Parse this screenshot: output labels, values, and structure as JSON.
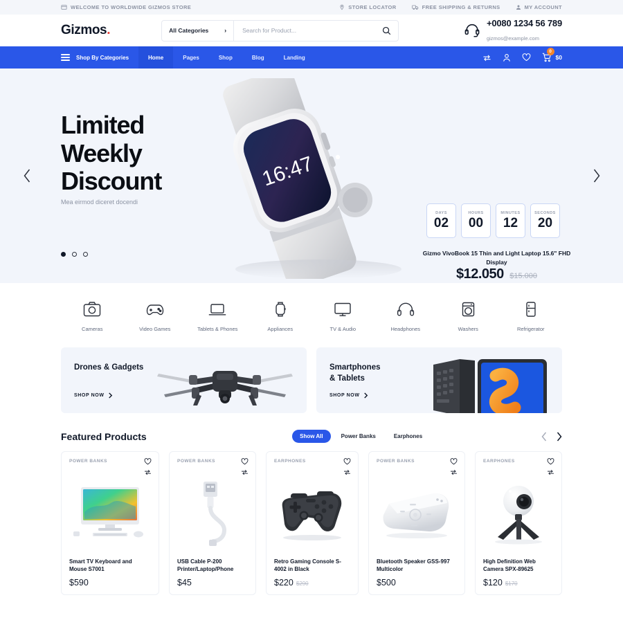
{
  "topbar": {
    "welcome": "WELCOME TO WORLDWIDE GIZMOS STORE",
    "welcome_icon": "store-icon",
    "links": [
      {
        "label": "STORE LOCATOR",
        "icon": "map-pin-icon"
      },
      {
        "label": "FREE SHIPPING & RETURNS",
        "icon": "truck-icon"
      },
      {
        "label": "MY ACCOUNT",
        "icon": "user-icon"
      }
    ]
  },
  "header": {
    "logo": "Gizmos",
    "logo_dot": ".",
    "category_select": "All Categories",
    "search_placeholder": "Search for Product...",
    "search_value": "",
    "search_icon": "search-icon",
    "support_icon": "headset-icon",
    "phone": "+0080 1234 56 789",
    "email": "gizmos@example.com"
  },
  "nav": {
    "categories_label": "Shop By Categories",
    "items": [
      {
        "label": "Home",
        "active": true
      },
      {
        "label": "Pages",
        "active": false
      },
      {
        "label": "Shop",
        "active": false
      },
      {
        "label": "Blog",
        "active": false
      },
      {
        "label": "Landing",
        "active": false
      }
    ],
    "compare_icon": "compare-icon",
    "account_icon": "user-icon",
    "wishlist_icon": "heart-icon",
    "cart_icon": "cart-icon",
    "cart_count": "0",
    "cart_total": "$0",
    "accent_color": "#2a57e8",
    "badge_color": "#f5862b"
  },
  "hero": {
    "title_line1": "Limited",
    "title_line2": "Weekly",
    "title_line3": "Discount",
    "subtitle": "Mea eirmod diceret docendi",
    "prev_icon": "chevron-left-icon",
    "next_icon": "chevron-right-icon",
    "slide_dots": [
      true,
      false,
      false
    ],
    "countdown": [
      {
        "label": "DAYS",
        "value": "02"
      },
      {
        "label": "HOURS",
        "value": "00"
      },
      {
        "label": "MINUTES",
        "value": "12"
      },
      {
        "label": "SECONDS",
        "value": "20"
      }
    ],
    "product_name": "Gizmo VivoBook 15 Thin and Light Laptop 15.6\" FHD Display",
    "price": "$12.050",
    "old_price": "$15.000"
  },
  "categories": [
    {
      "label": "Cameras",
      "icon": "camera-icon"
    },
    {
      "label": "Video Games",
      "icon": "gamepad-icon"
    },
    {
      "label": "Tablets & Phones",
      "icon": "laptop-icon"
    },
    {
      "label": "Appliances",
      "icon": "smartwatch-icon"
    },
    {
      "label": "TV & Audio",
      "icon": "monitor-icon"
    },
    {
      "label": "Headphones",
      "icon": "headphones-icon"
    },
    {
      "label": "Washers",
      "icon": "washer-icon"
    },
    {
      "label": "Refrigerator",
      "icon": "fridge-icon"
    }
  ],
  "promos": [
    {
      "title": "Drones & Gadgets",
      "cta": "SHOP NOW",
      "cta_icon": "chevron-right-icon",
      "image": "drone-image"
    },
    {
      "title_line1": "Smartphones",
      "title_line2": "& Tablets",
      "title": "Smartphones & Tablets",
      "cta": "SHOP NOW",
      "cta_icon": "chevron-right-icon",
      "image": "tablet-keyboard-image"
    }
  ],
  "featured": {
    "title": "Featured Products",
    "tabs": [
      {
        "label": "Show All",
        "active": true
      },
      {
        "label": "Power Banks",
        "active": false
      },
      {
        "label": "Earphones",
        "active": false
      }
    ],
    "prev_icon": "chevron-left-icon",
    "next_icon": "chevron-right-icon",
    "wishlist_icon": "heart-icon",
    "compare_icon": "compare-icon",
    "products": [
      {
        "tag": "POWER BANKS",
        "name": "Smart TV Keyboard and Mouse S7001",
        "price": "$590",
        "old_price": "",
        "image": "monitor-image"
      },
      {
        "tag": "POWER BANKS",
        "name": "USB Cable P-200 Printer/Laptop/Phone",
        "price": "$45",
        "old_price": "",
        "image": "usb-cable-image"
      },
      {
        "tag": "EARPHONES",
        "name": "Retro Gaming Console S-4002 in Black",
        "price": "$220",
        "old_price": "$290",
        "image": "gamepad-image"
      },
      {
        "tag": "POWER BANKS",
        "name": "Bluetooth Speaker GSS-997 Multicolor",
        "price": "$500",
        "old_price": "",
        "image": "speaker-image"
      },
      {
        "tag": "EARPHONES",
        "name": "High Definition Web Camera SPX-89625",
        "price": "$120",
        "old_price": "$170",
        "image": "webcam-image"
      }
    ]
  }
}
